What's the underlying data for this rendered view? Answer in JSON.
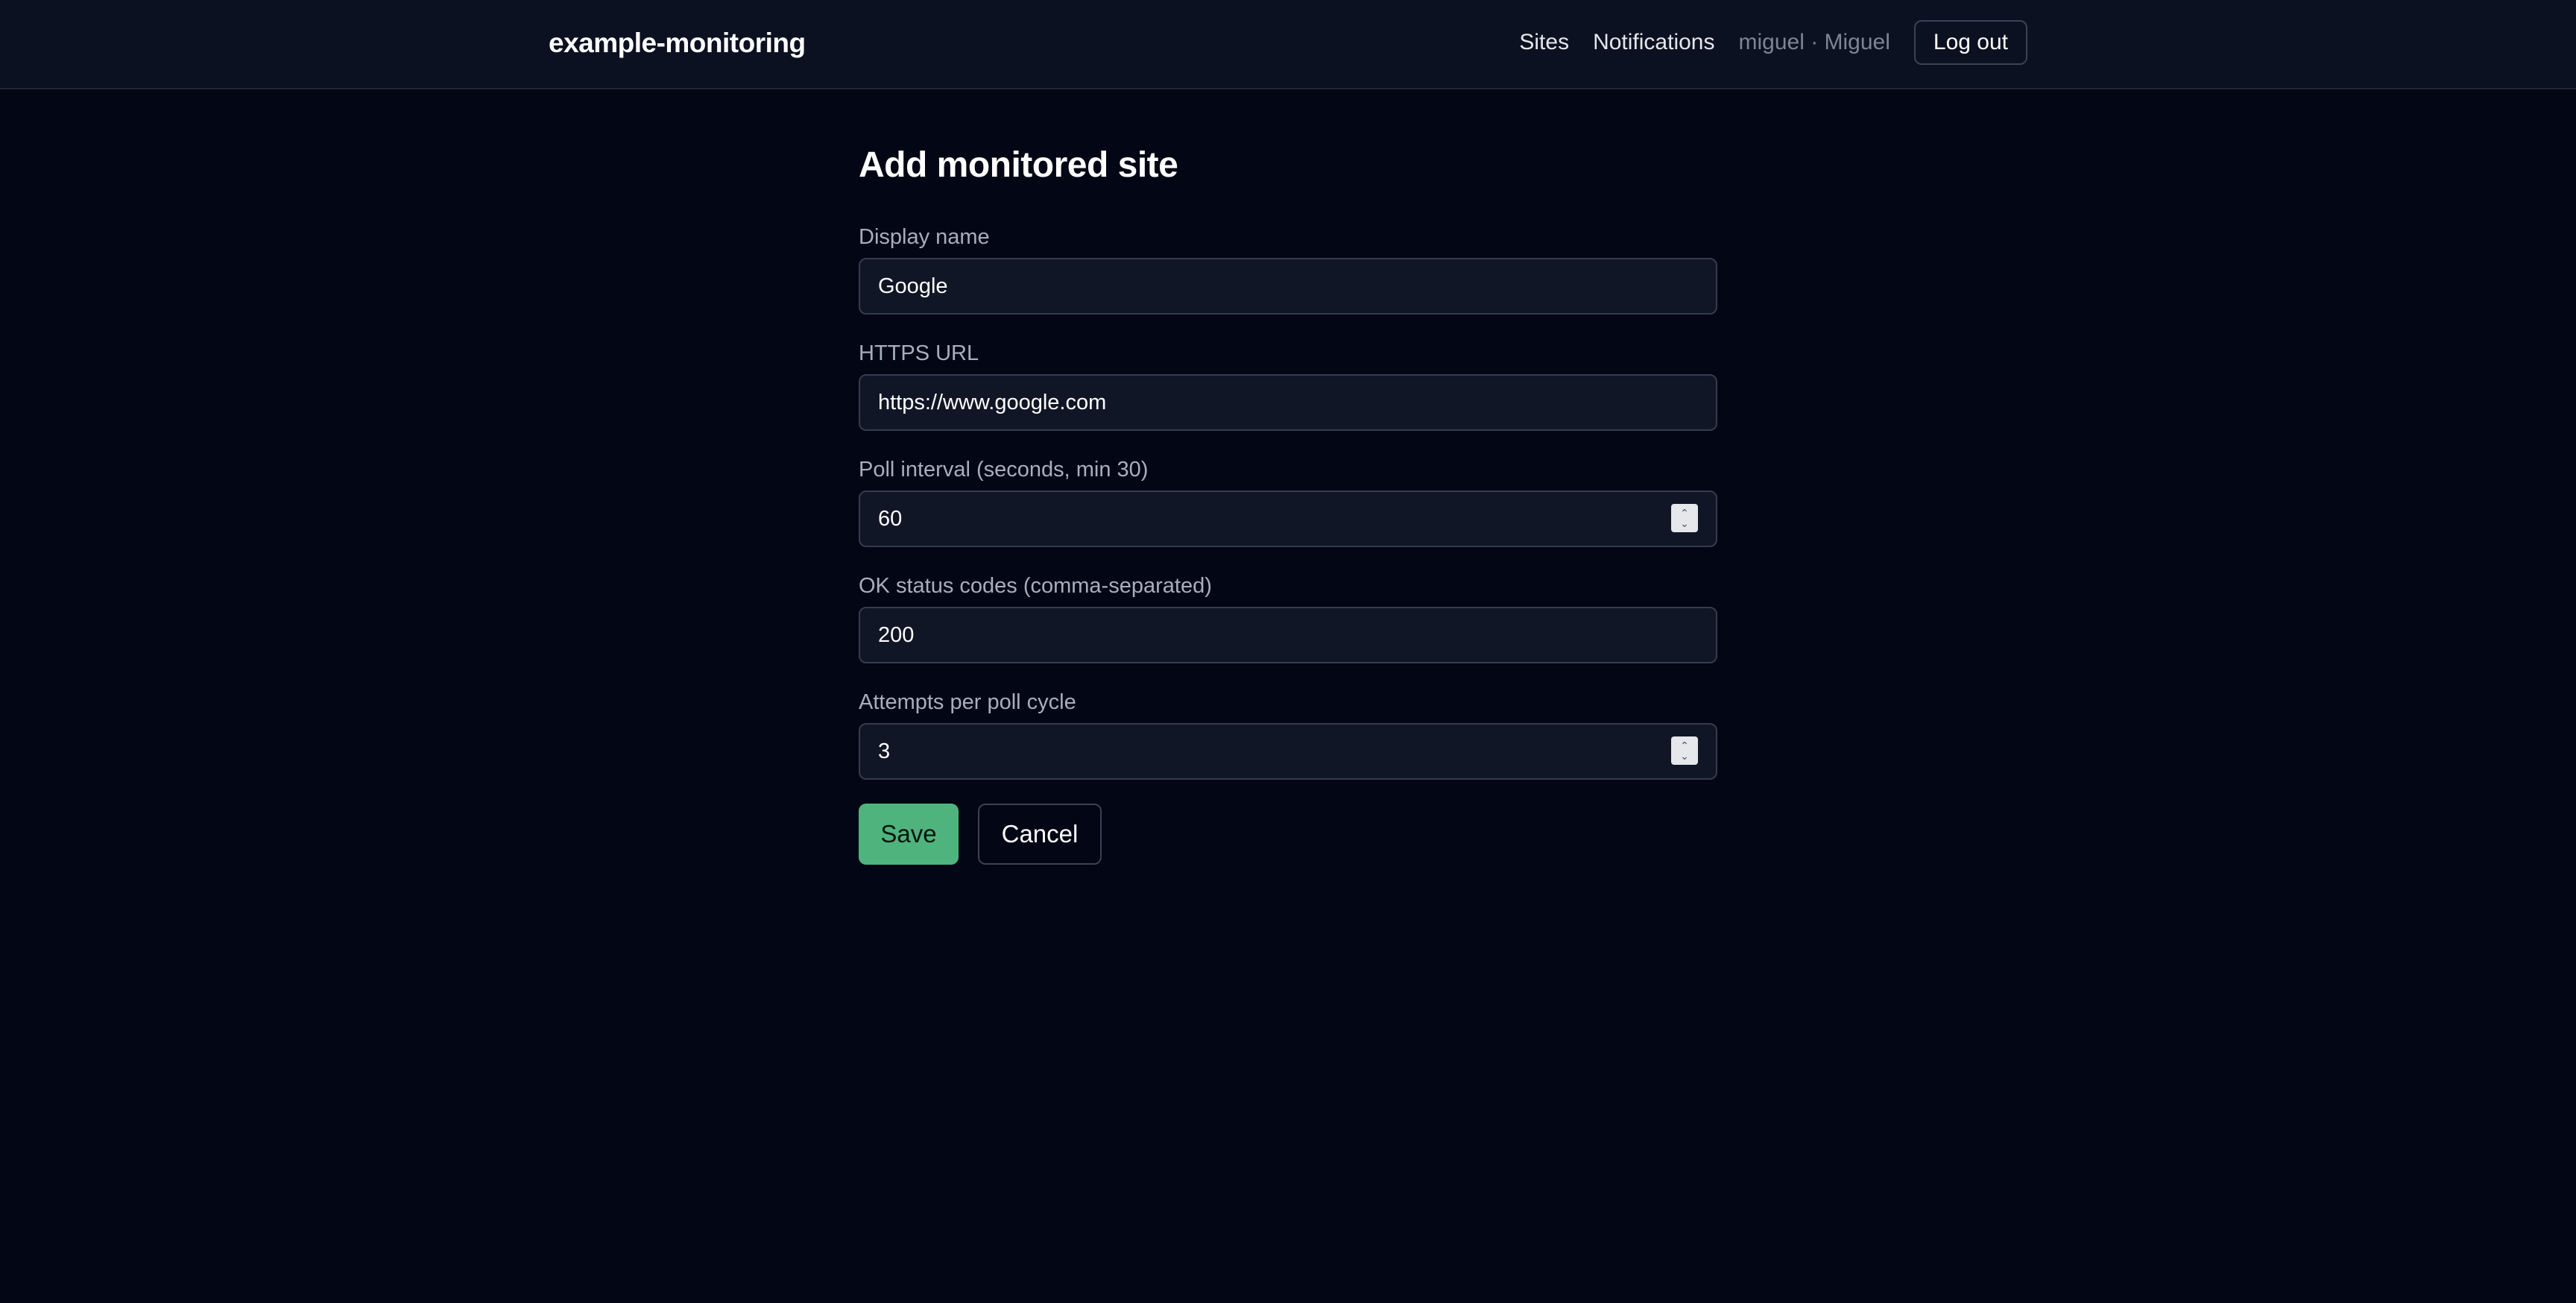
{
  "header": {
    "brand": "example-monitoring",
    "nav": {
      "sites": "Sites",
      "notifications": "Notifications"
    },
    "user": "miguel · Miguel",
    "logout_label": "Log out"
  },
  "form": {
    "title": "Add monitored site",
    "fields": {
      "display_name": {
        "label": "Display name",
        "value": "Google"
      },
      "https_url": {
        "label": "HTTPS URL",
        "value": "https://www.google.com"
      },
      "poll_interval": {
        "label": "Poll interval (seconds, min 30)",
        "value": "60"
      },
      "ok_status_codes": {
        "label": "OK status codes (comma-separated)",
        "value": "200"
      },
      "attempts": {
        "label": "Attempts per poll cycle",
        "value": "3"
      }
    },
    "save_label": "Save",
    "cancel_label": "Cancel"
  },
  "colors": {
    "background": "#030614",
    "header_bg": "#0c1121",
    "input_bg": "#111626",
    "accent_green": "#4fb37e"
  }
}
